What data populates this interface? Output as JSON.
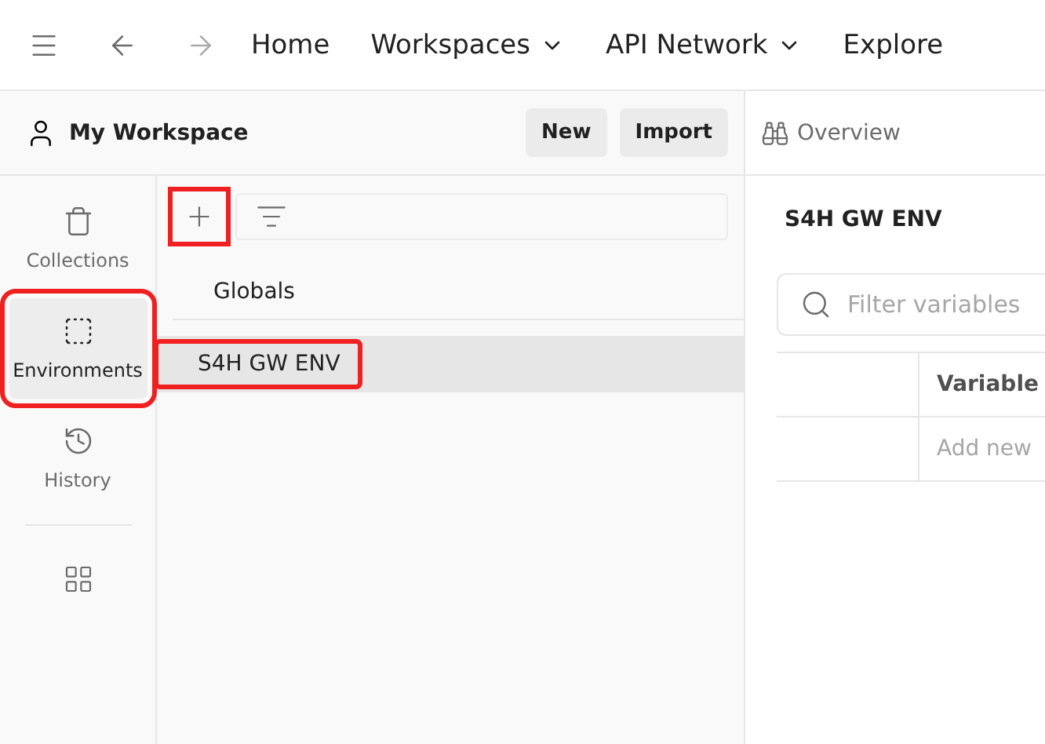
{
  "nav": {
    "items": [
      {
        "label": "Home",
        "dropdown": false
      },
      {
        "label": "Workspaces",
        "dropdown": true
      },
      {
        "label": "API Network",
        "dropdown": true
      },
      {
        "label": "Explore",
        "dropdown": false
      }
    ]
  },
  "workspace": {
    "title": "My Workspace",
    "buttons": [
      "New",
      "Import"
    ]
  },
  "tab": {
    "label": "Overview"
  },
  "rail": [
    {
      "kind": "collections",
      "label": "Collections",
      "selected": false,
      "highlighted": false
    },
    {
      "kind": "environments",
      "label": "Environments",
      "selected": true,
      "highlighted": true
    },
    {
      "kind": "history",
      "label": "History",
      "selected": false,
      "highlighted": false
    }
  ],
  "toolbar": {
    "add_highlighted": true
  },
  "environments": [
    {
      "name": "Globals",
      "selected": false,
      "highlighted": false
    },
    {
      "name": "S4H GW ENV",
      "selected": true,
      "highlighted": true
    }
  ],
  "detail": {
    "title": "S4H GW ENV",
    "search": {
      "placeholder": "Filter variables"
    },
    "columns": [
      "Variable"
    ],
    "new_row": "Add new"
  }
}
